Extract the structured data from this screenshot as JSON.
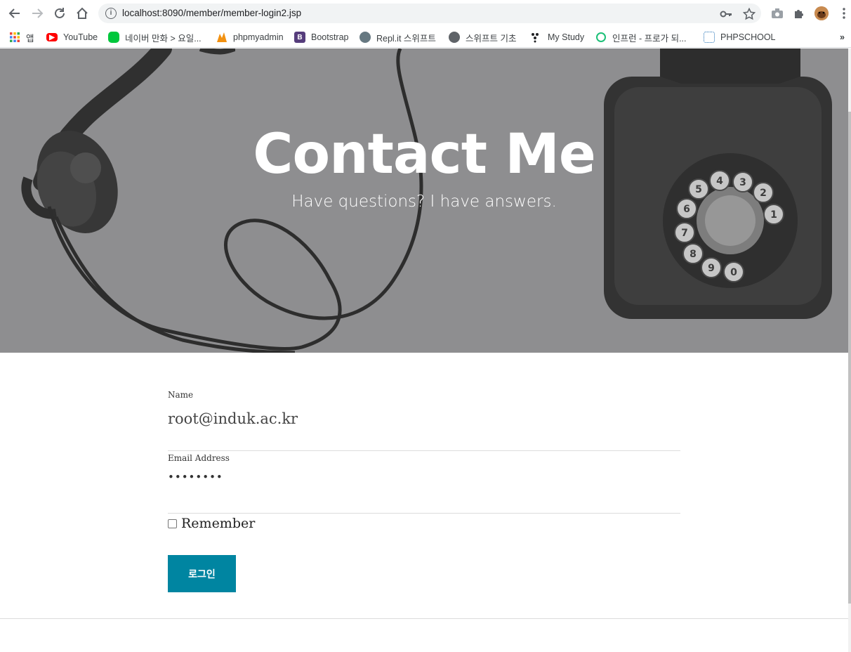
{
  "browser": {
    "url": "localhost:8090/member/member-login2.jsp",
    "bookmarks": [
      {
        "label": "앱",
        "icon": "apps-grid-icon"
      },
      {
        "label": "YouTube",
        "icon": "youtube-icon",
        "color": "#ff0000"
      },
      {
        "label": "네이버 만화 > 요일...",
        "icon": "naver-webtoon-icon",
        "color": "#00c73c"
      },
      {
        "label": "phpmyadmin",
        "icon": "phpmyadmin-icon",
        "color": "#f29111"
      },
      {
        "label": "Bootstrap",
        "icon": "bootstrap-icon",
        "color": "#563d7c"
      },
      {
        "label": "Repl.it 스위프트",
        "icon": "replit-icon",
        "color": "#667881"
      },
      {
        "label": "스위프트 기초",
        "icon": "globe-icon",
        "color": "#5f6368"
      },
      {
        "label": "My Study",
        "icon": "mystudy-icon",
        "color": "#202124"
      },
      {
        "label": "인프런 - 프로가 되...",
        "icon": "inflearn-icon",
        "color": "#1dc078"
      },
      {
        "label": "PHPSCHOOL",
        "icon": "phpschool-icon",
        "color": "#1f6fb5"
      }
    ],
    "overflow_label": "»"
  },
  "hero": {
    "title": "Contact Me",
    "subtitle": "Have questions? I have answers."
  },
  "form": {
    "name_label": "Name",
    "name_value": "root@induk.ac.kr",
    "email_label": "Email Address",
    "password_value": "••••••••",
    "remember_label": "Remember",
    "remember_checked": false,
    "submit_label": "로그인",
    "accent_color": "#0085a1"
  }
}
